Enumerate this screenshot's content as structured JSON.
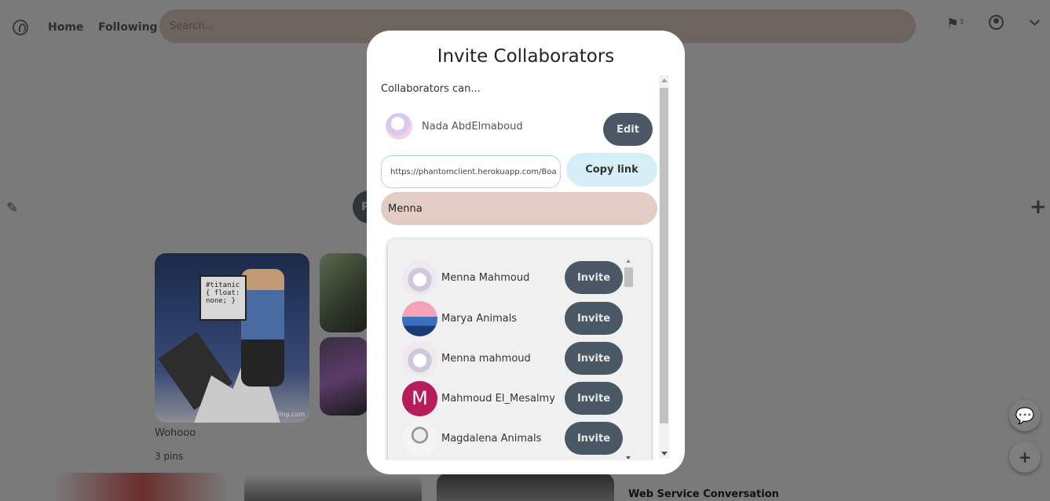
{
  "nav": {
    "home": "Home",
    "following": "Following",
    "search_placeholder": "Search...",
    "notification_count": "3"
  },
  "background": {
    "peek_button_letter": "P",
    "board": {
      "title": "Wohooo",
      "pins": "3 pins"
    },
    "pin_card_title": "Web Service Conversation",
    "image_watermark": "comic.browserling.com",
    "bubble_text": "#titanic { float: none; }"
  },
  "modal": {
    "title": "Invite Collaborators",
    "collaborators_can": "Collaborators can...",
    "owner": {
      "name": "Nada AbdElmaboud"
    },
    "edit_label": "Edit",
    "link_value": "https://phantomclient.herokuapp.com/Boa",
    "copy_link_label": "Copy link",
    "search_value": "Menna",
    "invite_label": "Invite",
    "results": [
      {
        "name": "Menna Mahmoud",
        "avatar": "anime-avatar"
      },
      {
        "name": "Marya Animals",
        "avatar": "sea-avatar"
      },
      {
        "name": "Menna mahmoud",
        "avatar": "anime-avatar"
      },
      {
        "name": "Mahmoud El_Mesalmy",
        "avatar": "letter-avatar",
        "initial": "M"
      },
      {
        "name": "Magdalena Animals",
        "avatar": "sketch-avatar"
      }
    ]
  },
  "colors": {
    "overlay": "#7a7a7a",
    "button_dark": "#4a5865",
    "copy_button": "#d4f0f6",
    "search_field": "#e2ccc4",
    "letter_avatar": "#b71c5a"
  }
}
